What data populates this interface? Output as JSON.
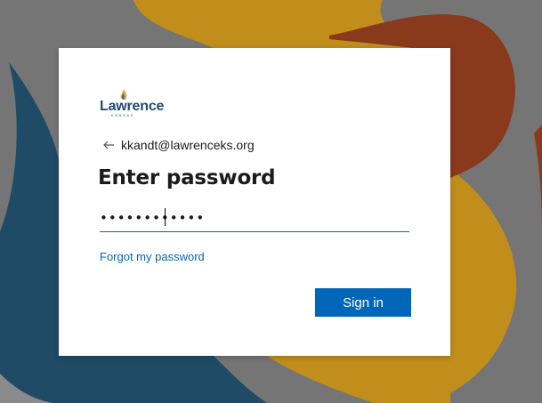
{
  "colors": {
    "accent": "#0067b8",
    "background_gray": "#757575",
    "flame_blue": "#1f4b67",
    "flame_gold": "#c18e1b",
    "flame_rust": "#8a3a1c",
    "logo_text": "#1f4b74"
  },
  "brand": {
    "wordmark": "Lawrence",
    "tagline": "KANSAS",
    "logo_icon": "flame-logo-icon"
  },
  "identity": {
    "back_icon": "arrow-left-icon",
    "email": "kkandt@lawrenceks.org"
  },
  "title": "Enter password",
  "password": {
    "value": "••••••••••••"
  },
  "forgot_link": "Forgot my password",
  "sign_in_label": "Sign in"
}
